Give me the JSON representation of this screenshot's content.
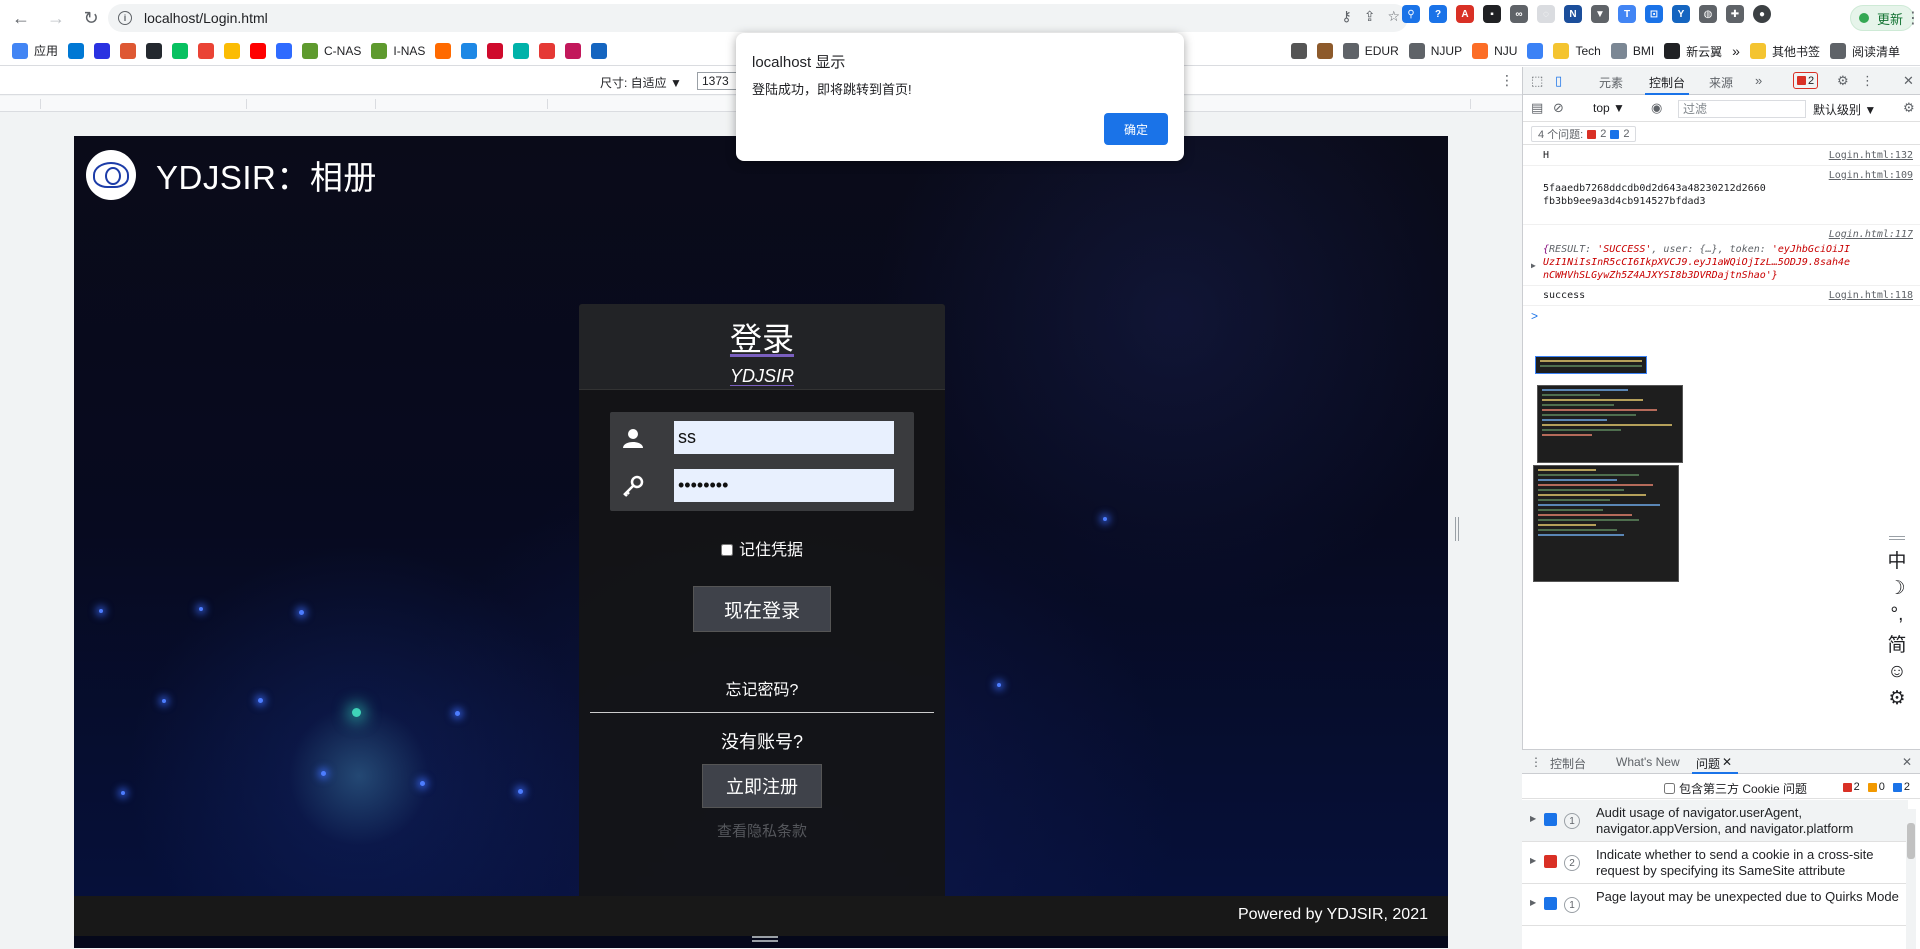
{
  "browser": {
    "url": "localhost/Login.html",
    "update_label": "更新",
    "bookmarks": [
      {
        "label": "应用",
        "color": "#4285f4"
      },
      {
        "label": "",
        "color": "#0078d4"
      },
      {
        "label": "",
        "color": "#2932e1"
      },
      {
        "label": "",
        "color": "#de5833"
      },
      {
        "label": "",
        "color": "#24292f"
      },
      {
        "label": "",
        "color": "#07c160"
      },
      {
        "label": "",
        "color": "#ea4335"
      },
      {
        "label": "",
        "color": "#fbbc04"
      },
      {
        "label": "",
        "color": "#ff0000"
      },
      {
        "label": "",
        "color": "#2f6bff"
      },
      {
        "label": "C-NAS",
        "color": "#5e9a2e"
      },
      {
        "label": "I-NAS",
        "color": "#5e9a2e"
      },
      {
        "label": "",
        "color": "#ff6a00"
      },
      {
        "label": "",
        "color": "#1e88e5"
      },
      {
        "label": "",
        "color": "#cf0a2c"
      },
      {
        "label": "",
        "color": "#00b2a9"
      },
      {
        "label": "",
        "color": "#e53935"
      },
      {
        "label": "",
        "color": "#c2185b"
      },
      {
        "label": "",
        "color": "#1565c0"
      }
    ],
    "bookmarks_right": [
      {
        "label": "",
        "color": "#555555"
      },
      {
        "label": "",
        "color": "#8d5a2b"
      },
      {
        "label": "EDUR",
        "color": "#5f6368"
      },
      {
        "label": "NJUP",
        "color": "#5f6368"
      },
      {
        "label": "NJU",
        "color": "#fc6d26"
      },
      {
        "label": "",
        "color": "#3b82f6"
      },
      {
        "label": "Tech",
        "color": "#f4c430"
      },
      {
        "label": "BMI",
        "color": "#7b8794"
      },
      {
        "label": "新云翼",
        "color": "#202124"
      }
    ],
    "other_bookmarks": "其他书签",
    "reading_list": "阅读清单"
  },
  "device_toolbar": {
    "dimensions_label": "尺寸: 自适应 ▼",
    "width_value": "1373"
  },
  "site": {
    "title": "YDJSIR：相册",
    "footer": "Powered by YDJSIR, 2021"
  },
  "login": {
    "heading": "登录",
    "subheading": "YDJSIR",
    "username_value": "ss",
    "password_value": "••••••••",
    "remember_label": "记住凭据",
    "login_button": "现在登录",
    "forgot_link": "忘记密码?",
    "no_account": "没有账号?",
    "register_button": "立即注册",
    "privacy_link": "查看隐私条款"
  },
  "alert": {
    "title": "localhost 显示",
    "message": "登陆成功，即将跳转到首页!",
    "ok_button": "确定"
  },
  "devtools": {
    "tabs": [
      "元素",
      "控制台",
      "来源"
    ],
    "active_tab": "控制台",
    "error_count": "2",
    "context": "top ▼",
    "filter_placeholder": "过滤",
    "levels": "默认级别 ▼",
    "issues_label": "4 个问题:",
    "issues_errors": "2",
    "issues_info": "2",
    "console": [
      {
        "text": "H",
        "source": "Login.html:132"
      },
      {
        "text": "5faaedb7268ddcdb0d2d643a48230212d2660\nfb3bb9ee9a3d4cb914527bfdad3",
        "source": "Login.html:109"
      },
      {
        "text": "success",
        "source": "Login.html:118"
      }
    ],
    "object_log": {
      "source": "Login.html:117",
      "line1_key1": "RESULT: ",
      "line1_val1": "'SUCCESS'",
      "line1_key2": ", user: {…}, token: ",
      "line1_val2": "'eyJhbGciOiJI",
      "line2": "UzI1NiIsInR5cCI6IkpXVCJ9.eyJ1aWQiOjIzL…5ODJ9.8sah4e",
      "line3": "nCWHVhSLGywZh5Z4AJXYSI8b3DVRDajtnShao'}"
    },
    "prompt": ">",
    "drawer_tabs": [
      "控制台",
      "What's New",
      "问题"
    ],
    "drawer_active": "问题",
    "cookie_label": "包含第三方 Cookie 问题",
    "count_errors": "2",
    "count_warnings": "0",
    "count_info": "2",
    "issues": [
      {
        "count": "1",
        "kind": "info",
        "text": "Audit usage of navigator.userAgent, navigator.appVersion, and navigator.platform"
      },
      {
        "count": "2",
        "kind": "error",
        "text": "Indicate whether to send a cookie in a cross-site request by specifying its SameSite attribute"
      },
      {
        "count": "1",
        "kind": "info",
        "text": "Page layout may be unexpected due to Quirks Mode"
      }
    ]
  },
  "ime": [
    "中",
    "☽",
    "°,",
    "简",
    "☺",
    "⚙"
  ],
  "colors": {
    "accent": "#1a73e8",
    "error": "#d93025",
    "page_bg": "#05081a",
    "card_bg": "#141416"
  }
}
